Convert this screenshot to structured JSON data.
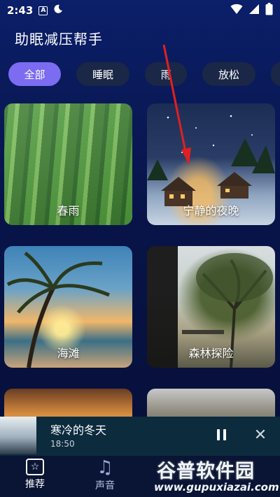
{
  "status_bar": {
    "time": "2:43",
    "notif_badge": "A"
  },
  "app": {
    "title": "助眠减压帮手"
  },
  "tabs": [
    {
      "label": "全部",
      "active": true
    },
    {
      "label": "睡眠",
      "active": false
    },
    {
      "label": "雨",
      "active": false
    },
    {
      "label": "放松",
      "active": false
    },
    {
      "label": "",
      "active": false
    }
  ],
  "cards": [
    {
      "label": "春雨"
    },
    {
      "label": "宁静的夜晚"
    },
    {
      "label": "海滩"
    },
    {
      "label": "森林探险"
    },
    {
      "label": ""
    },
    {
      "label": ""
    }
  ],
  "player": {
    "title": "寒冷的冬天",
    "time": "18:50"
  },
  "nav": [
    {
      "label": "推荐",
      "icon": "star-box-icon"
    },
    {
      "label": "声音",
      "icon": "music-note-icon"
    }
  ],
  "watermark": {
    "title": "谷普软件园",
    "url": "www.gupuxiazai.com"
  },
  "colors": {
    "accent": "#7b6cf2",
    "annotation_arrow": "#e02020"
  }
}
